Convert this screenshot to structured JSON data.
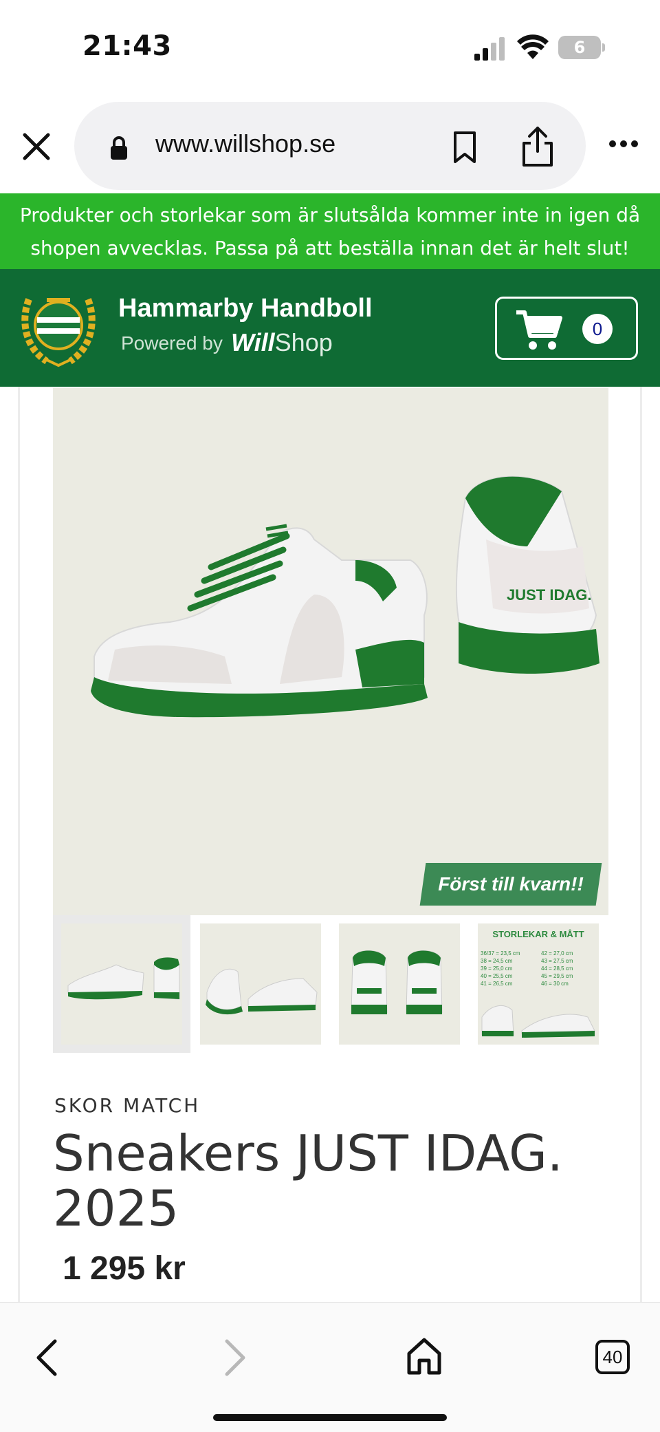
{
  "status_bar": {
    "time": "21:43",
    "battery": "6"
  },
  "browser": {
    "url": "www.willshop.se",
    "tab_count": "40"
  },
  "notice": {
    "line1": "Produkter och storlekar som är slutsålda kommer inte in igen då",
    "line2": "shopen avvecklas. Passa på att beställa innan det är helt slut!"
  },
  "store": {
    "name": "Hammarby Handboll",
    "powered_by": "Powered by",
    "platform_bold": "Will",
    "platform_rest": "Shop",
    "cart_count": "0"
  },
  "product": {
    "image_badge": "Först till kvarn!!",
    "category": "SKOR MATCH",
    "title_line1": "Sneakers JUST IDAG.",
    "title_line2": "2025",
    "price": "1 295 kr",
    "shoe_text": "JUST IDAG."
  },
  "size_chart": {
    "title": "STORLEKAR & MÅTT",
    "left": [
      "36/37 = 23,5 cm",
      "38 = 24,5 cm",
      "39 = 25,0 cm",
      "40 = 25,5 cm",
      "41 = 26,5 cm"
    ],
    "right": [
      "42 = 27,0 cm",
      "43 = 27,5 cm",
      "44 = 28,5 cm",
      "45 = 29,5 cm",
      "46 = 30 cm"
    ]
  },
  "colors": {
    "notice_green": "#2bb52b",
    "header_green": "#0f6b34",
    "shoe_green": "#1f7a2e"
  }
}
